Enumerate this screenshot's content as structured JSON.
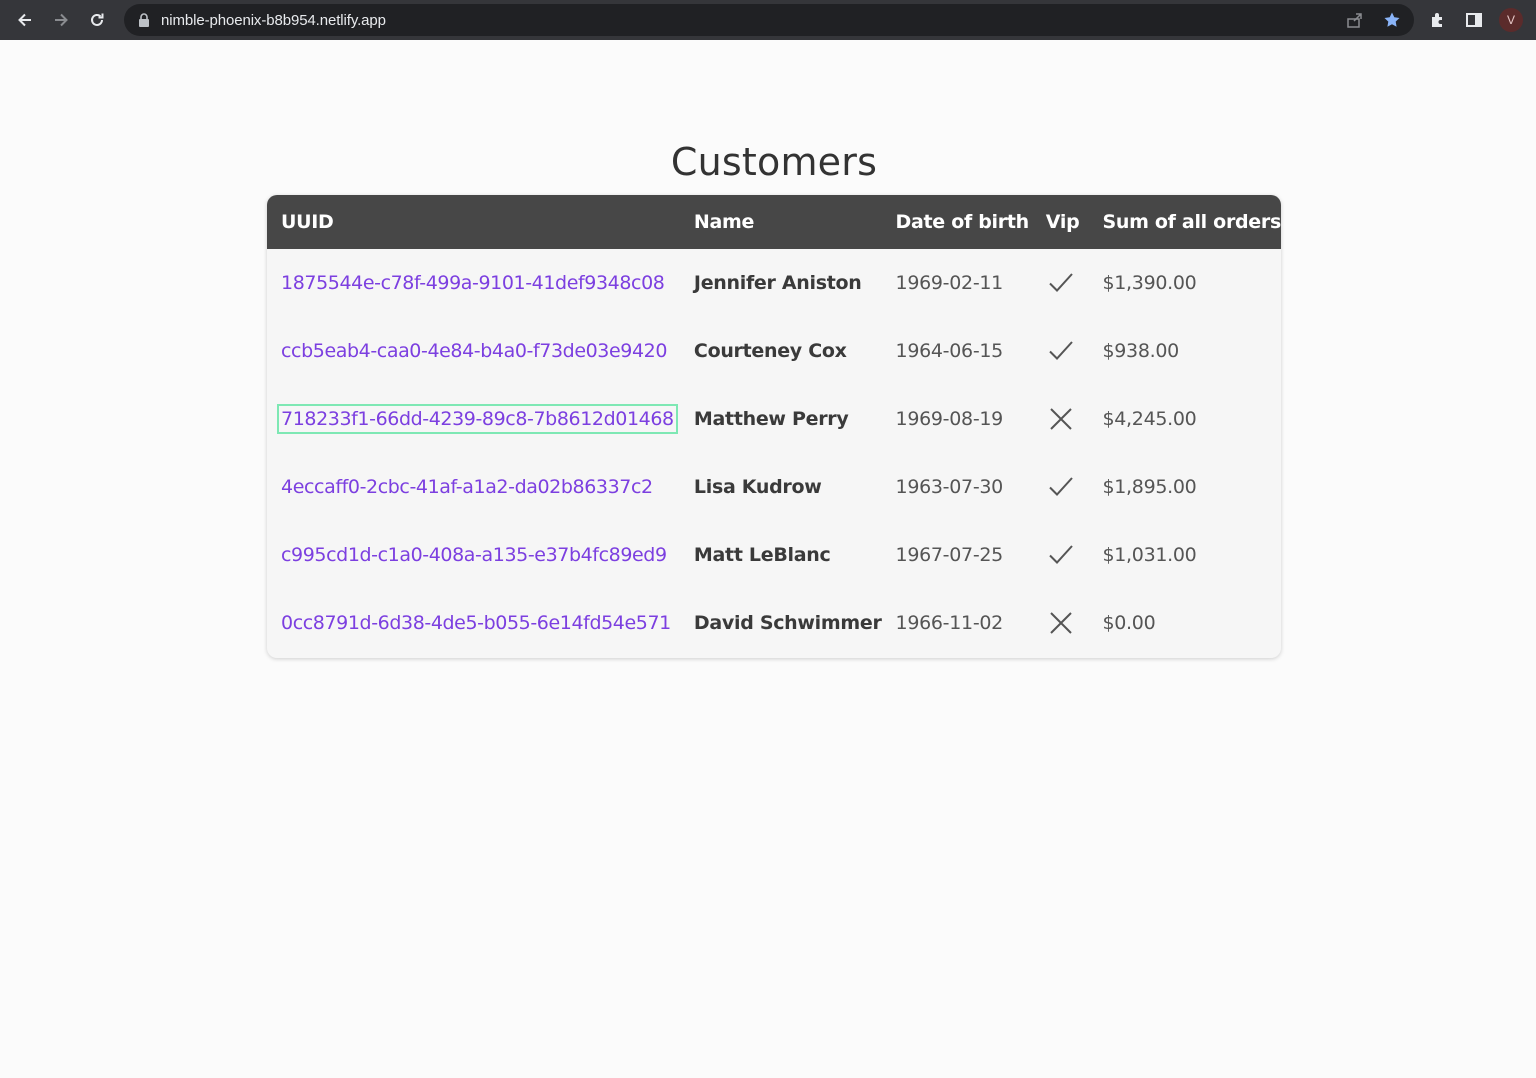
{
  "browser": {
    "url": "nimble-phoenix-b8b954.netlify.app",
    "profile_initial": "V"
  },
  "page": {
    "title": "Customers"
  },
  "table": {
    "headers": {
      "uuid": "UUID",
      "name": "Name",
      "dob": "Date of birth",
      "vip": "Vip",
      "sum": "Sum of all orders"
    },
    "rows": [
      {
        "uuid": "1875544e-c78f-499a-9101-41def9348c08",
        "name": "Jennifer Aniston",
        "dob": "1969-02-11",
        "vip": "check-icon",
        "sum": "$1,390.00"
      },
      {
        "uuid": "ccb5eab4-caa0-4e84-b4a0-f73de03e9420",
        "name": "Courteney Cox",
        "dob": "1964-06-15",
        "vip": "check-icon",
        "sum": "$938.00"
      },
      {
        "uuid": "718233f1-66dd-4239-89c8-7b8612d01468",
        "name": "Matthew Perry",
        "dob": "1969-08-19",
        "vip": "x-icon",
        "sum": "$4,245.00"
      },
      {
        "uuid": "4eccaff0-2cbc-41af-a1a2-da02b86337c2",
        "name": "Lisa Kudrow",
        "dob": "1963-07-30",
        "vip": "check-icon",
        "sum": "$1,895.00"
      },
      {
        "uuid": "c995cd1d-c1a0-408a-a135-e37b4fc89ed9",
        "name": "Matt LeBlanc",
        "dob": "1967-07-25",
        "vip": "check-icon",
        "sum": "$1,031.00"
      },
      {
        "uuid": "0cc8791d-6d38-4de5-b055-6e14fd54e571",
        "name": "David Schwimmer",
        "dob": "1966-11-02",
        "vip": "x-icon",
        "sum": "$0.00"
      }
    ]
  },
  "colors": {
    "link": "#7c3fe0",
    "header_bg": "#474747",
    "focus_outline": "#7ee8b4"
  }
}
